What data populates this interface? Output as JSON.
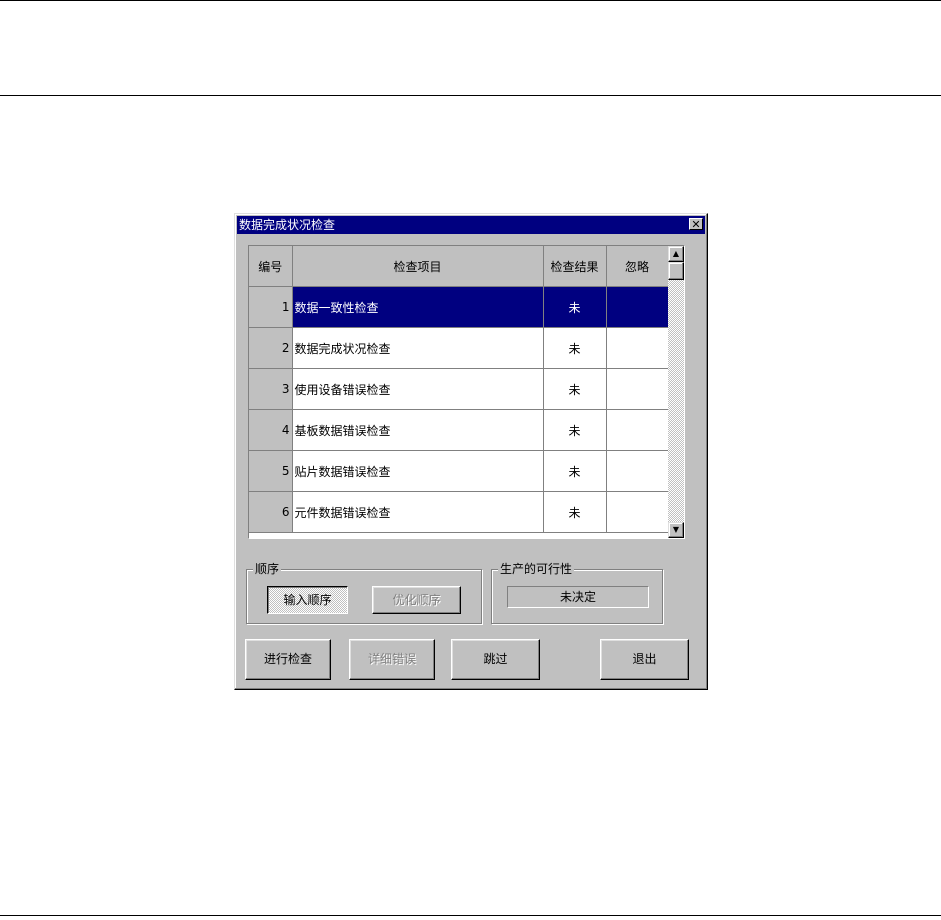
{
  "dialog": {
    "title": "数据完成状况检查",
    "close_label": "✕"
  },
  "grid": {
    "columns": [
      "编号",
      "检查项目",
      "检查结果",
      "忽略"
    ],
    "rows": [
      {
        "num": "1",
        "item": "数据一致性检查",
        "result": "未",
        "ignore": ""
      },
      {
        "num": "2",
        "item": "数据完成状况检查",
        "result": "未",
        "ignore": ""
      },
      {
        "num": "3",
        "item": "使用设备错误检查",
        "result": "未",
        "ignore": ""
      },
      {
        "num": "4",
        "item": "基板数据错误检查",
        "result": "未",
        "ignore": ""
      },
      {
        "num": "5",
        "item": "贴片数据错误检查",
        "result": "未",
        "ignore": ""
      },
      {
        "num": "6",
        "item": "元件数据错误检查",
        "result": "未",
        "ignore": ""
      }
    ],
    "selected_row": 1
  },
  "order_group": {
    "legend": "顺序",
    "input_order_label": "输入顺序",
    "optimized_order_label": "优化顺序"
  },
  "feasibility_group": {
    "legend": "生产的可行性",
    "value": "未决定"
  },
  "buttons": {
    "run_check": "进行检查",
    "detail_errors": "详细错误",
    "skip": "跳过",
    "exit": "退出"
  },
  "scrollbar": {
    "up_arrow": "▲",
    "down_arrow": "▼"
  },
  "colors": {
    "selection": "#000080",
    "face": "#c0c0c0"
  }
}
